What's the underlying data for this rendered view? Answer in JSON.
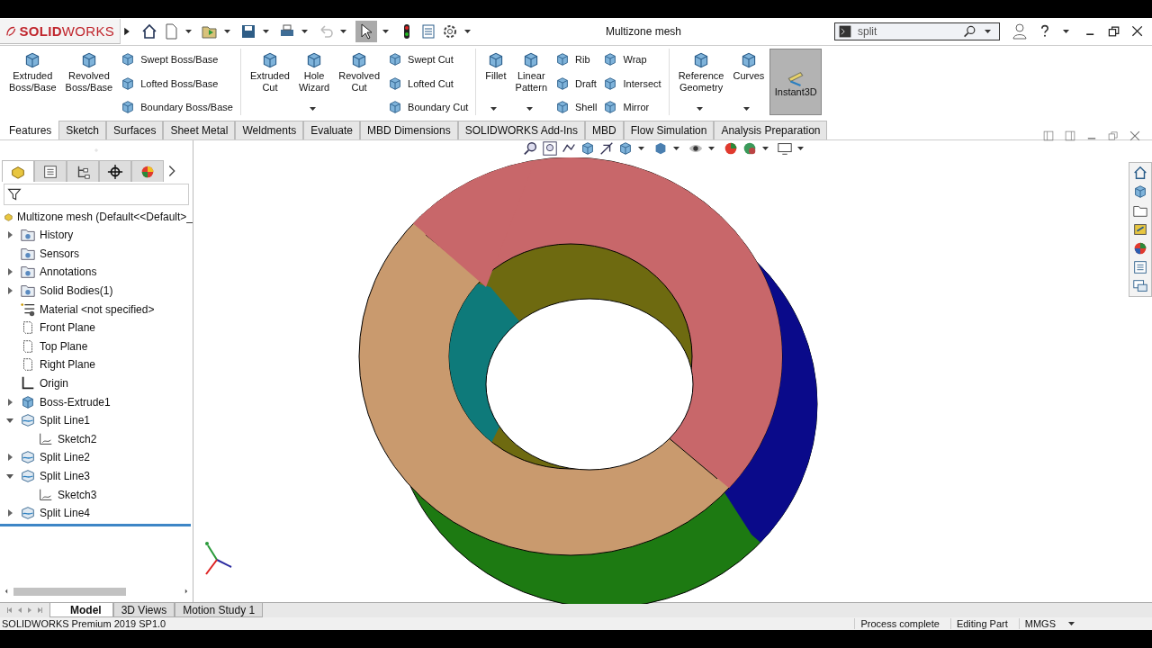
{
  "window": {
    "logo": "**SOLID**WORKS",
    "title": "Multizone mesh"
  },
  "search": {
    "value": "split"
  },
  "ribbon": {
    "columns": [
      {
        "kind": "large",
        "label": "Extruded\nBoss/Base",
        "selected": false,
        "dropdown": false
      },
      {
        "kind": "large",
        "label": "Revolved\nBoss/Base",
        "selected": false,
        "dropdown": false
      },
      {
        "kind": "stack",
        "items": [
          "Swept Boss/Base",
          "Lofted Boss/Base",
          "Boundary Boss/Base"
        ]
      },
      {
        "kind": "separator"
      },
      {
        "kind": "large",
        "label": "Extruded\nCut",
        "selected": false,
        "dropdown": false
      },
      {
        "kind": "large",
        "label": "Hole\nWizard",
        "selected": false,
        "dropdown": true
      },
      {
        "kind": "large",
        "label": "Revolved\nCut",
        "selected": false,
        "dropdown": false
      },
      {
        "kind": "stack",
        "items": [
          "Swept Cut",
          "Lofted Cut",
          "Boundary Cut"
        ]
      },
      {
        "kind": "separator"
      },
      {
        "kind": "large",
        "label": "Fillet",
        "selected": false,
        "dropdown": true
      },
      {
        "kind": "large",
        "label": "Linear\nPattern",
        "selected": false,
        "dropdown": true
      },
      {
        "kind": "stack",
        "items": [
          "Rib",
          "Draft",
          "Shell"
        ]
      },
      {
        "kind": "stack",
        "items": [
          "Wrap",
          "Intersect",
          "Mirror"
        ]
      },
      {
        "kind": "separator"
      },
      {
        "kind": "large",
        "label": "Reference\nGeometry",
        "selected": false,
        "dropdown": true
      },
      {
        "kind": "large",
        "label": "Curves",
        "selected": false,
        "dropdown": true
      },
      {
        "kind": "large",
        "label": "Instant3D",
        "selected": true,
        "dropdown": false
      }
    ]
  },
  "tabs": [
    {
      "label": "Features",
      "selected": true
    },
    {
      "label": "Sketch",
      "selected": false
    },
    {
      "label": "Surfaces",
      "selected": false
    },
    {
      "label": "Sheet Metal",
      "selected": false
    },
    {
      "label": "Weldments",
      "selected": false
    },
    {
      "label": "Evaluate",
      "selected": false
    },
    {
      "label": "MBD Dimensions",
      "selected": false
    },
    {
      "label": "SOLIDWORKS Add-Ins",
      "selected": false
    },
    {
      "label": "MBD",
      "selected": false
    },
    {
      "label": "Flow Simulation",
      "selected": false
    },
    {
      "label": "Analysis Preparation",
      "selected": false
    }
  ],
  "panel_tabs": [
    {
      "selected": true
    },
    {
      "selected": false
    },
    {
      "selected": false
    },
    {
      "selected": false
    },
    {
      "selected": false
    }
  ],
  "feature_tree": {
    "root": "Multizone mesh  (Default<<Default>_",
    "items": [
      {
        "label": "History",
        "kind": "folder",
        "expanded": false
      },
      {
        "label": "Sensors",
        "kind": "folder"
      },
      {
        "label": "Annotations",
        "kind": "folder",
        "expanded": false
      },
      {
        "label": "Solid Bodies(1)",
        "kind": "folder",
        "expanded": false
      },
      {
        "label": "Material <not specified>",
        "kind": "material"
      },
      {
        "label": "Front Plane",
        "kind": "plane"
      },
      {
        "label": "Top Plane",
        "kind": "plane"
      },
      {
        "label": "Right Plane",
        "kind": "plane"
      },
      {
        "label": "Origin",
        "kind": "origin"
      },
      {
        "label": "Boss-Extrude1",
        "kind": "body",
        "expanded": false
      },
      {
        "label": "Split Line1",
        "kind": "split",
        "expanded": true,
        "children": [
          {
            "label": "Sketch2",
            "kind": "sketch"
          }
        ]
      },
      {
        "label": "Split Line2",
        "kind": "split",
        "expanded": false
      },
      {
        "label": "Split Line3",
        "kind": "split",
        "expanded": true,
        "children": [
          {
            "label": "Sketch3",
            "kind": "sketch"
          }
        ]
      },
      {
        "label": "Split Line4",
        "kind": "split",
        "expanded": false
      }
    ]
  },
  "bottom_tabs": [
    {
      "label": "Model",
      "selected": true
    },
    {
      "label": "3D Views",
      "selected": false
    },
    {
      "label": "Motion Study 1",
      "selected": false
    }
  ],
  "status_bar": {
    "product": "SOLIDWORKS Premium 2019 SP1.0",
    "items": [
      "Process complete",
      "Editing Part",
      "MMGS"
    ]
  }
}
